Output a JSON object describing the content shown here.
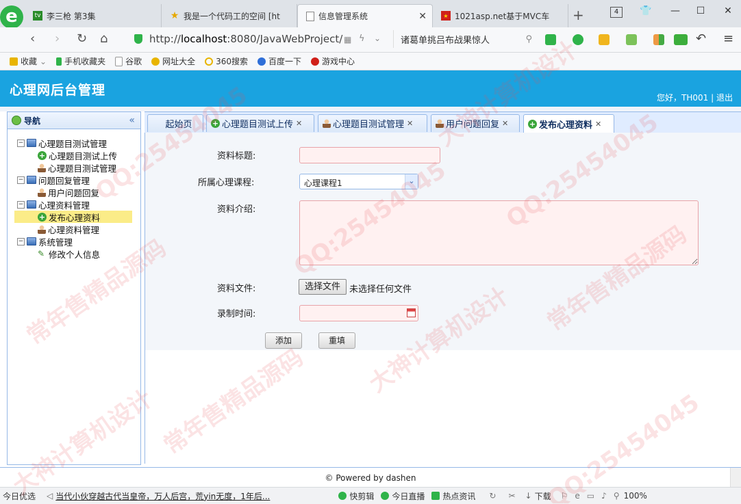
{
  "browser": {
    "tabs": [
      {
        "label": "李三枪 第3集",
        "icon": "video-icon"
      },
      {
        "label": "我是一个代码工的空间 [ht",
        "icon": "star-icon"
      },
      {
        "label": "信息管理系统",
        "icon": "page-icon",
        "active": true
      },
      {
        "label": "1021asp.net基于MVC车",
        "icon": "flag-icon"
      }
    ],
    "tab_count": "4",
    "url_prefix": "http://",
    "url_host": "localhost",
    "url_rest": ":8080/JavaWebProject/",
    "search_text": "诸葛单挑吕布战果惊人",
    "bookmarks": [
      "收藏",
      "手机收藏夹",
      "谷歌",
      "网址大全",
      "360搜索",
      "百度一下",
      "游戏中心"
    ]
  },
  "app": {
    "title": "心理网后台管理",
    "greeting": "您好，TH001",
    "separator": "|",
    "logout": "退出"
  },
  "nav": {
    "title": "导航",
    "collapse": "«",
    "groups": [
      {
        "label": "心理题目测试管理",
        "children": [
          "心理题目测试上传",
          "心理题目测试管理"
        ]
      },
      {
        "label": "问题回复管理",
        "children": [
          "用户问题回复"
        ]
      },
      {
        "label": "心理资料管理",
        "children": [
          "发布心理资料",
          "心理资料管理"
        ]
      },
      {
        "label": "系统管理",
        "children": [
          "修改个人信息"
        ]
      }
    ]
  },
  "tabs": [
    {
      "label": "起始页"
    },
    {
      "label": "心理题目测试上传"
    },
    {
      "label": "心理题目测试管理"
    },
    {
      "label": "用户问题回复"
    },
    {
      "label": "发布心理资料"
    }
  ],
  "form": {
    "title_label": "资料标题:",
    "course_label": "所属心理课程:",
    "course_value": "心理课程1",
    "intro_label": "资料介绍:",
    "file_label": "资料文件:",
    "file_button": "选择文件",
    "file_status": "未选择任何文件",
    "time_label": "录制时间:",
    "add_button": "添加",
    "reset_button": "重填"
  },
  "footer": {
    "text": "© Powered by dashen"
  },
  "statusbar": {
    "left": "今日优选",
    "news": "当代小伙穿越古代当皇帝，万人后宫，荒yin无度，1年后...",
    "items": [
      "快剪辑",
      "今日直播",
      "热点资讯",
      "下载"
    ],
    "zoom": "100%"
  },
  "watermark": [
    "QQ:25454045",
    "常年售精品源码",
    "大神计算机设计"
  ],
  "colors": {
    "header": "#1aa3e0",
    "nav_border": "#95b8e7",
    "selected": "#fbec88",
    "input_invalid": "#fff1f1"
  }
}
